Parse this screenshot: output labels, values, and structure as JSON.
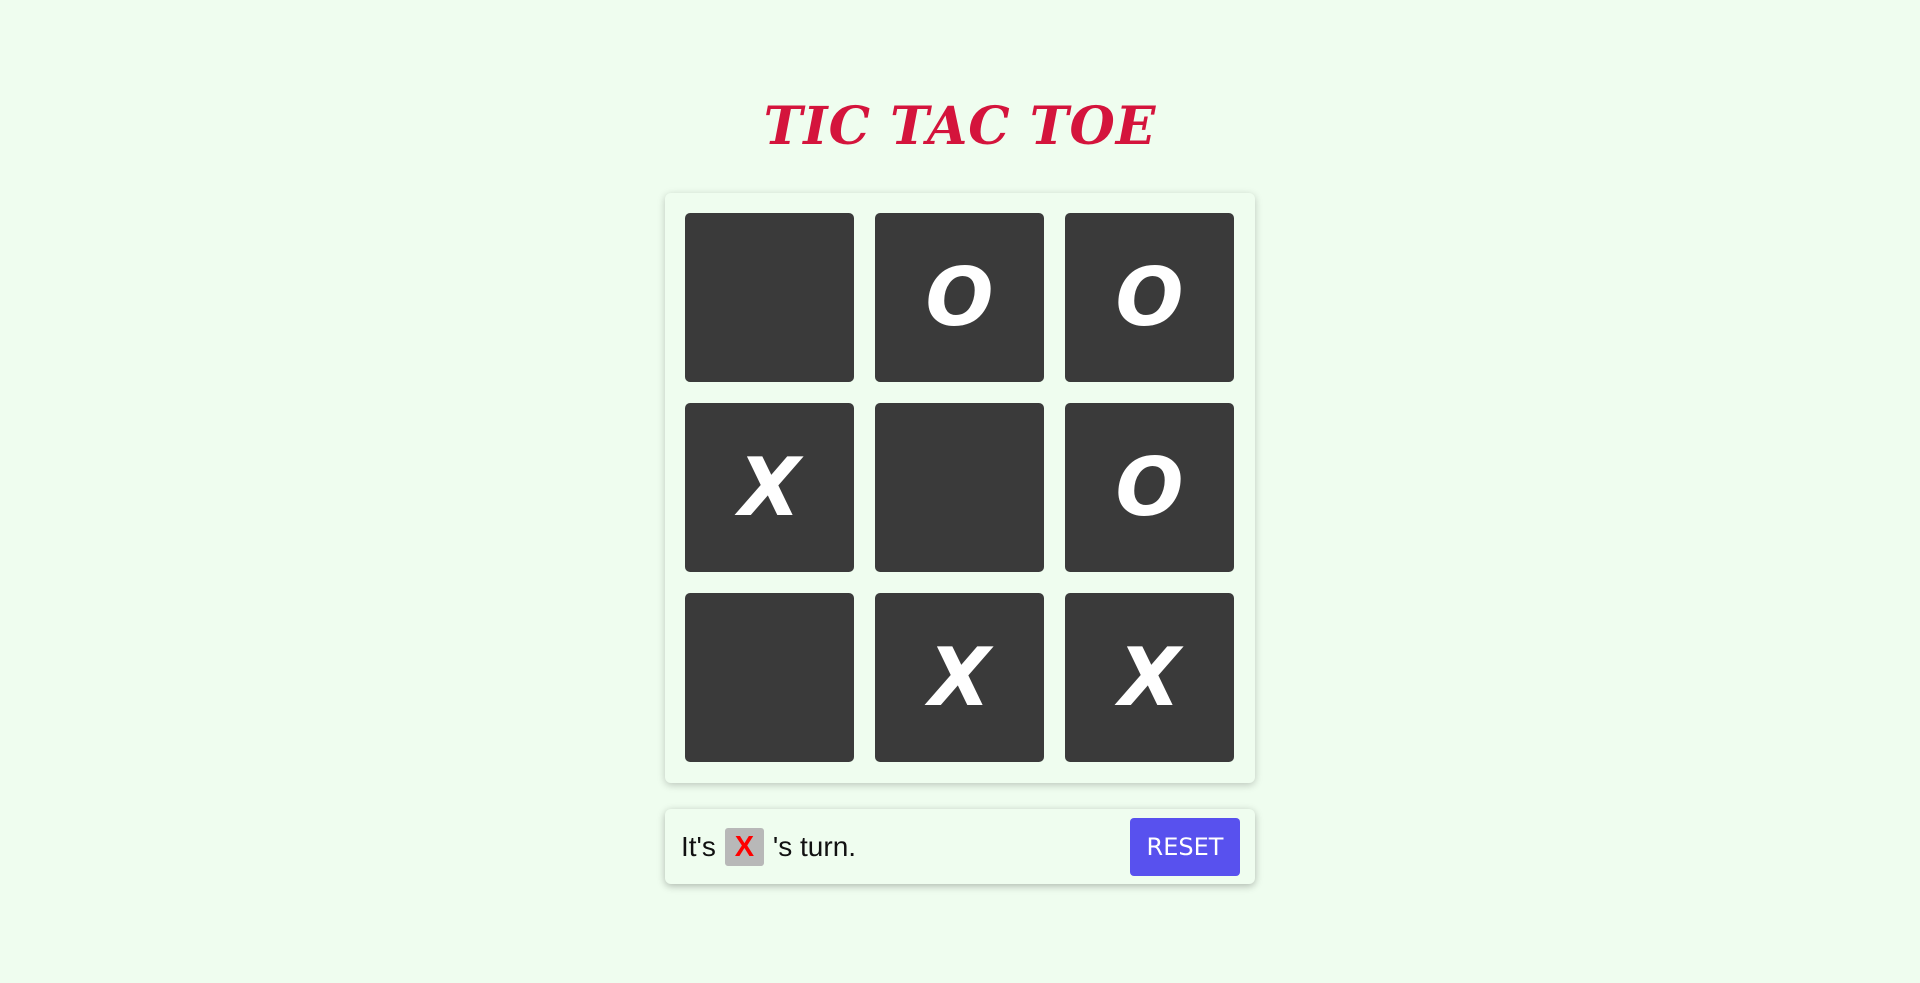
{
  "title": "TIC TAC TOE",
  "board": {
    "cells": [
      "",
      "O",
      "O",
      "X",
      "",
      "O",
      "",
      "X",
      "X"
    ]
  },
  "status": {
    "prefix": "It's",
    "current_player": "X",
    "suffix": "'s turn."
  },
  "reset_label": "RESET",
  "colors": {
    "background": "#effdef",
    "title": "#d4143c",
    "cell_bg": "#3a3a3a",
    "mark": "#ffffff",
    "panel_bg": "#effdef",
    "turn_badge_bg": "#b8b8b8",
    "turn_badge_text": "#ff0000",
    "reset_bg": "#5851ee"
  }
}
